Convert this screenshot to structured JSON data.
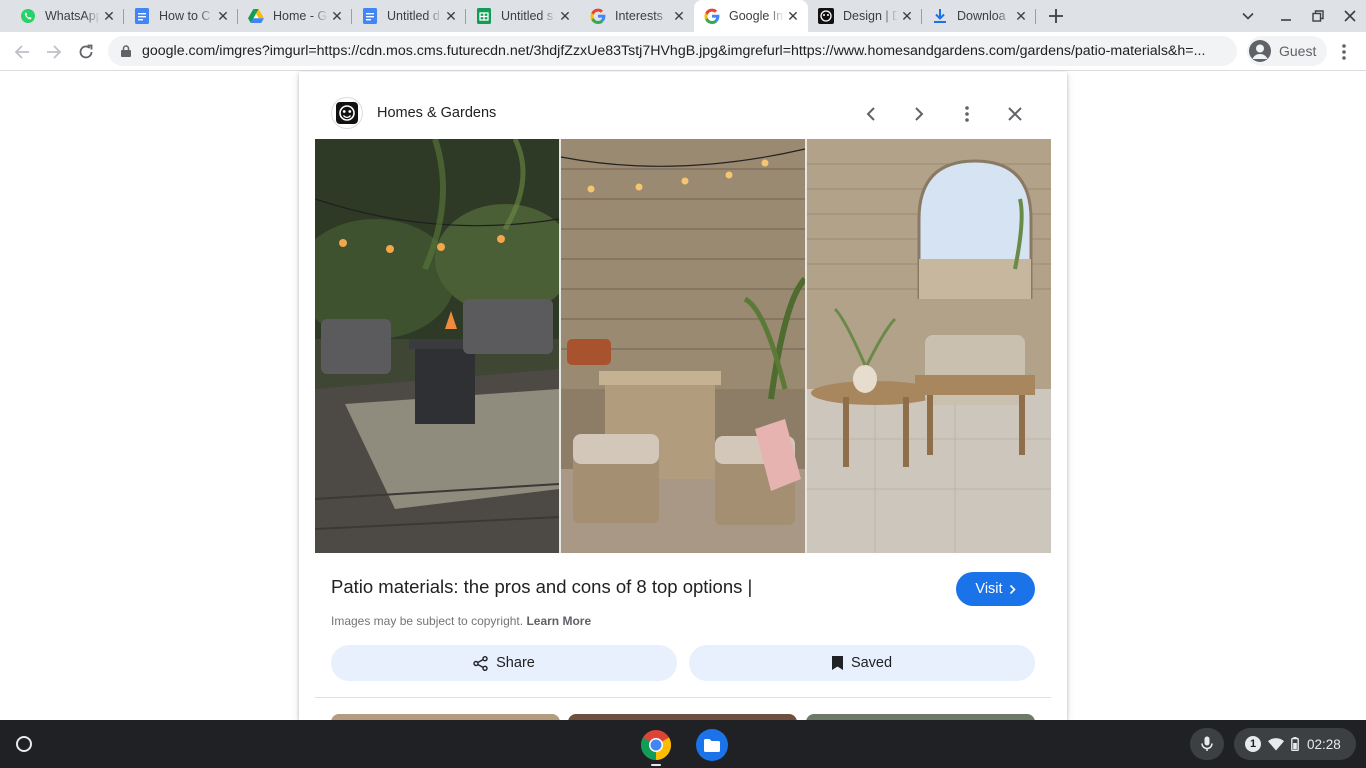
{
  "browser": {
    "tabs": [
      {
        "title": "WhatsApp",
        "icon": "whatsapp-icon",
        "active": false
      },
      {
        "title": "How to C",
        "icon": "google-docs-icon",
        "active": false
      },
      {
        "title": "Home - G",
        "icon": "google-drive-icon",
        "active": false
      },
      {
        "title": "Untitled d",
        "icon": "google-docs-icon",
        "active": false
      },
      {
        "title": "Untitled s",
        "icon": "google-sheets-icon",
        "active": false
      },
      {
        "title": "Interests",
        "icon": "google-icon",
        "active": false
      },
      {
        "title": "Google Im",
        "icon": "google-icon",
        "active": true
      },
      {
        "title": "Design | D",
        "icon": "homes-and-gardens-icon",
        "active": false
      },
      {
        "title": "Downloa",
        "icon": "download-icon",
        "active": false
      }
    ],
    "address_bar": {
      "url": "google.com/imgres?imgurl=https://cdn.mos.cms.futurecdn.net/3hdjfZzxUe83Tstj7HVhgB.jpg&imgrefurl=https://www.homesandgardens.com/gardens/patio-materials&h=..."
    },
    "profile": {
      "label": "Guest"
    }
  },
  "image_panel": {
    "source_name": "Homes & Gardens",
    "title": "Patio materials: the pros and cons of 8 top options |",
    "visit_label": "Visit",
    "copyright_text": "Images may be subject to copyright.",
    "learn_more_label": "Learn More",
    "share_label": "Share",
    "saved_label": "Saved"
  },
  "shelf": {
    "apps": [
      {
        "name": "Chrome",
        "icon": "chrome-icon"
      },
      {
        "name": "Files",
        "icon": "files-icon"
      }
    ],
    "notification_count": "1",
    "time": "02:28"
  },
  "colors": {
    "accent": "#1a73e8",
    "tabstrip_bg": "#dee1e6",
    "action_button_bg": "#e8f0fe",
    "shelf_bg": "#202124"
  }
}
